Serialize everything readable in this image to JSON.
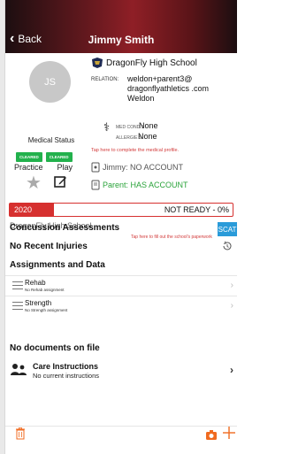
{
  "header": {
    "back_label": "Back",
    "title": "Jimmy Smith"
  },
  "profile": {
    "initials": "JS",
    "medical_status_label": "Medical Status",
    "badges": [
      "CLEARED",
      "CLEARED"
    ],
    "practice_label": "Practice",
    "play_label": "Play",
    "school": "DragonFly High School",
    "relation_label": "RELATION:",
    "relation_value": "weldon+parent3@ dragonflyathletics .com Weldon",
    "med_cond_label": "MED COND S",
    "med_cond_value": "None",
    "allergies_label": "ALLERGIE S",
    "allergies_value": "None",
    "tap_medical": "Tap here to complete the medical profile.",
    "athlete_account": "Jimmy: NO ACCOUNT",
    "parent_account": "Parent: HAS ACCOUNT"
  },
  "year_status": {
    "year": "2020",
    "status": "NOT READY - 0%",
    "progress_fraction": 0.2
  },
  "team": {
    "name": "DragonFly High School",
    "tap_paperwork": "Tap here to fill out the school's paperwork"
  },
  "sections": {
    "concussion": "Concussion Assessments",
    "scat_button": "SCAT",
    "injuries": "No Recent Injuries",
    "assignments": "Assignments and Data",
    "documents": "No documents on file"
  },
  "assignments": [
    {
      "name": "Rehab",
      "sub": "No Rehab assignment"
    },
    {
      "name": "Strength",
      "sub": "No Strength assignment"
    }
  ],
  "care": {
    "name": "Care Instructions",
    "sub": "No current instructions"
  },
  "colors": {
    "accent_red": "#d6302f",
    "cleared_green": "#22b14c",
    "scat_blue": "#2a9bd9",
    "footer_orange": "#f06a1f"
  },
  "icons": [
    "star-icon",
    "edit-icon",
    "school-logo-icon",
    "caduceus-icon",
    "device-icon",
    "history-icon",
    "menu-lines-icon",
    "chevron-right-icon",
    "people-icon",
    "trash-icon",
    "camera-icon",
    "plus-icon"
  ]
}
